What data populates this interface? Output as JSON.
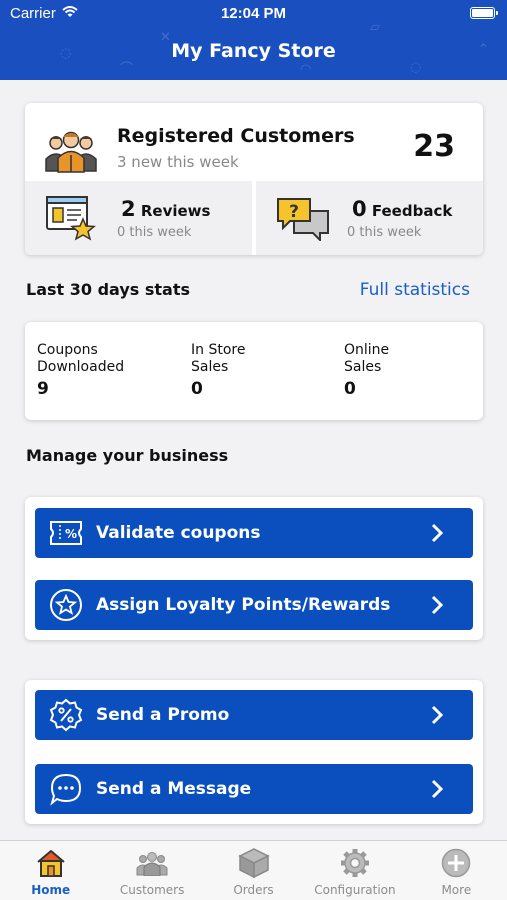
{
  "status": {
    "carrier": "Carrier",
    "time": "12:04 PM"
  },
  "header": {
    "title": "My Fancy Store"
  },
  "registered": {
    "title": "Registered Customers",
    "subtitle": "3 new this week",
    "count": "23",
    "reviews": {
      "count": "2",
      "label": "Reviews",
      "sub": "0 this week"
    },
    "feedback": {
      "count": "0",
      "label": "Feedback",
      "sub": "0 this week"
    }
  },
  "stats": {
    "title": "Last 30 days stats",
    "link": "Full statistics",
    "items": [
      {
        "label_line1": "Coupons",
        "label_line2": "Downloaded",
        "value": "9"
      },
      {
        "label_line1": "In Store",
        "label_line2": "Sales",
        "value": "0"
      },
      {
        "label_line1": "Online",
        "label_line2": "Sales",
        "value": "0"
      }
    ]
  },
  "manage": {
    "title": "Manage your business",
    "actions": [
      {
        "label": "Validate coupons",
        "icon": "coupon-icon"
      },
      {
        "label": "Assign Loyalty Points/Rewards",
        "icon": "star-badge-icon"
      },
      {
        "label": "Send a Promo",
        "icon": "percent-badge-icon"
      },
      {
        "label": "Send a Message",
        "icon": "chat-bubble-icon"
      }
    ]
  },
  "tabs": [
    {
      "label": "Home",
      "icon": "home-icon",
      "active": true
    },
    {
      "label": "Customers",
      "icon": "customers-icon",
      "active": false
    },
    {
      "label": "Orders",
      "icon": "box-icon",
      "active": false
    },
    {
      "label": "Configuration",
      "icon": "gear-icon",
      "active": false
    },
    {
      "label": "More",
      "icon": "plus-circle-icon",
      "active": false
    }
  ],
  "colors": {
    "primary": "#1a4fbf",
    "button": "#0a4fbd",
    "link": "#1a5ec9",
    "icon_yellow": "#f5c42c",
    "icon_orange": "#e8942a"
  }
}
